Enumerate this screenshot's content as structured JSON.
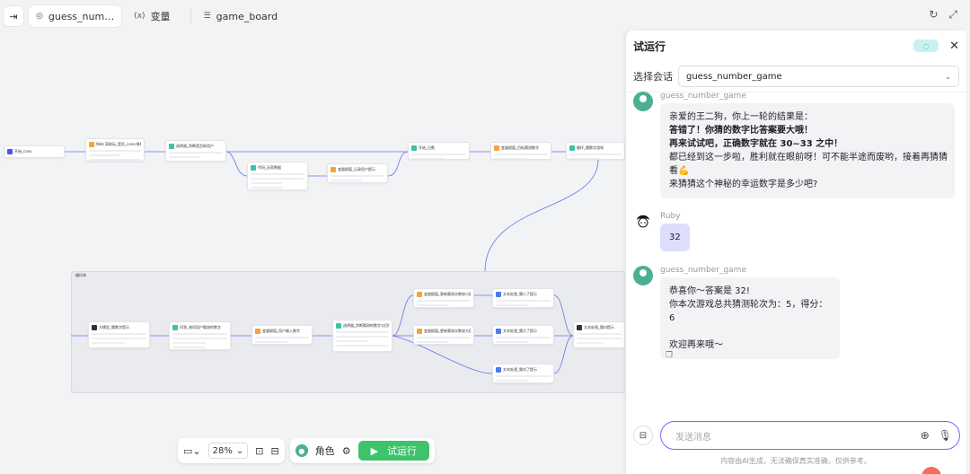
{
  "topbar": {
    "toggle_icon": "sidebar-toggle-icon",
    "tabs": [
      {
        "label": "guess_num…",
        "icon": "workflow-icon"
      },
      {
        "label": "变量",
        "icon": "variable-icon"
      },
      {
        "label": "game_board",
        "icon": "database-icon"
      }
    ]
  },
  "canvas": {
    "loop_title": "循环体",
    "nodes": [
      {
        "title": "开始_conv",
        "color": "#4d53e8"
      },
      {
        "title": "Web 获取玩_是否_conv/参数列表",
        "color": "#f3a53b"
      },
      {
        "title": "选择器_判断是否新用户",
        "color": "#3ec2a5"
      },
      {
        "title": "代码_玩家数据",
        "color": "#3ec2a5"
      },
      {
        "title": "过滤_询问游戏开始提示",
        "color": "#4d7be8"
      },
      {
        "title": "变量赋值_记录用户提示",
        "color": "#f3a53b"
      },
      {
        "title": "开始_记数",
        "color": "#3ec2a5"
      },
      {
        "title": "变量赋值_目标猜测数字",
        "color": "#f3a53b"
      },
      {
        "title": "循环_猜数字游戏",
        "color": "#3ec2a5"
      },
      {
        "title": "大模型_猜数字提示",
        "color": "#333333"
      },
      {
        "title": "问答_询问用户猜测的数字",
        "color": "#3ec2a5"
      },
      {
        "title": "变量赋值_用户输入数字",
        "color": "#f3a53b"
      },
      {
        "title": "选择器_判断猜测的数字与目标数字",
        "color": "#3ec2a5"
      },
      {
        "title": "变量赋值_更新猜测次数较小值",
        "color": "#f3a53b"
      },
      {
        "title": "文本处理_猜小了提示",
        "color": "#4d7be8"
      },
      {
        "title": "变量赋值_更新猜测次数较大值",
        "color": "#f3a53b"
      },
      {
        "title": "文本处理_猜大了提示",
        "color": "#4d7be8"
      },
      {
        "title": "文本处理_猜对了提示",
        "color": "#4d7be8"
      },
      {
        "title": "文本处理_猜对提示",
        "color": "#333333"
      }
    ]
  },
  "toolbar": {
    "zoom": "28%",
    "role_label": "角色",
    "run_label": "试运行",
    "layout_icon": "minimap-icon",
    "image_icon": "image-icon",
    "comment_icon": "comment-icon",
    "tool_icon": "wrench-icon"
  },
  "panel": {
    "title": "试运行",
    "close_icon": "close-icon",
    "session_label": "选择会话",
    "session_value": "guess_number_game",
    "messages": [
      {
        "sender": "guess_number_game",
        "role": "bot",
        "lines": [
          {
            "text": "亲爱的王二狗，你上一轮的结果是：",
            "bold": false
          },
          {
            "text": "答错了！你猜的数字比答案要大哦！",
            "bold": true
          },
          {
            "text": "再来试试吧，正确数字就在 30~33 之中！",
            "bold": true
          },
          {
            "text": "都已经到这一步啦，胜利就在眼前呀！可不能半途而废哟，接着再猜猜",
            "bold": false
          },
          {
            "text": "看💪",
            "bold": false
          },
          {
            "text": "来猜猜这个神秘的幸运数字是多少吧?",
            "bold": false
          }
        ]
      },
      {
        "sender": "Ruby",
        "role": "user",
        "lines": [
          {
            "text": "32",
            "bold": false
          }
        ]
      },
      {
        "sender": "guess_number_game",
        "role": "bot",
        "lines": [
          {
            "text": "恭喜你～答案是 32!",
            "bold": false
          },
          {
            "text": "你本次游戏总共猜测轮次为：5，得分：6",
            "bold": false
          },
          {
            "text": "",
            "bold": false
          },
          {
            "text": "欢迎再来哦～",
            "bold": false
          }
        ]
      }
    ],
    "input_placeholder": "发送消息",
    "disclaimer": "内容由AI生成，无法确保真实准确，仅供参考。"
  }
}
